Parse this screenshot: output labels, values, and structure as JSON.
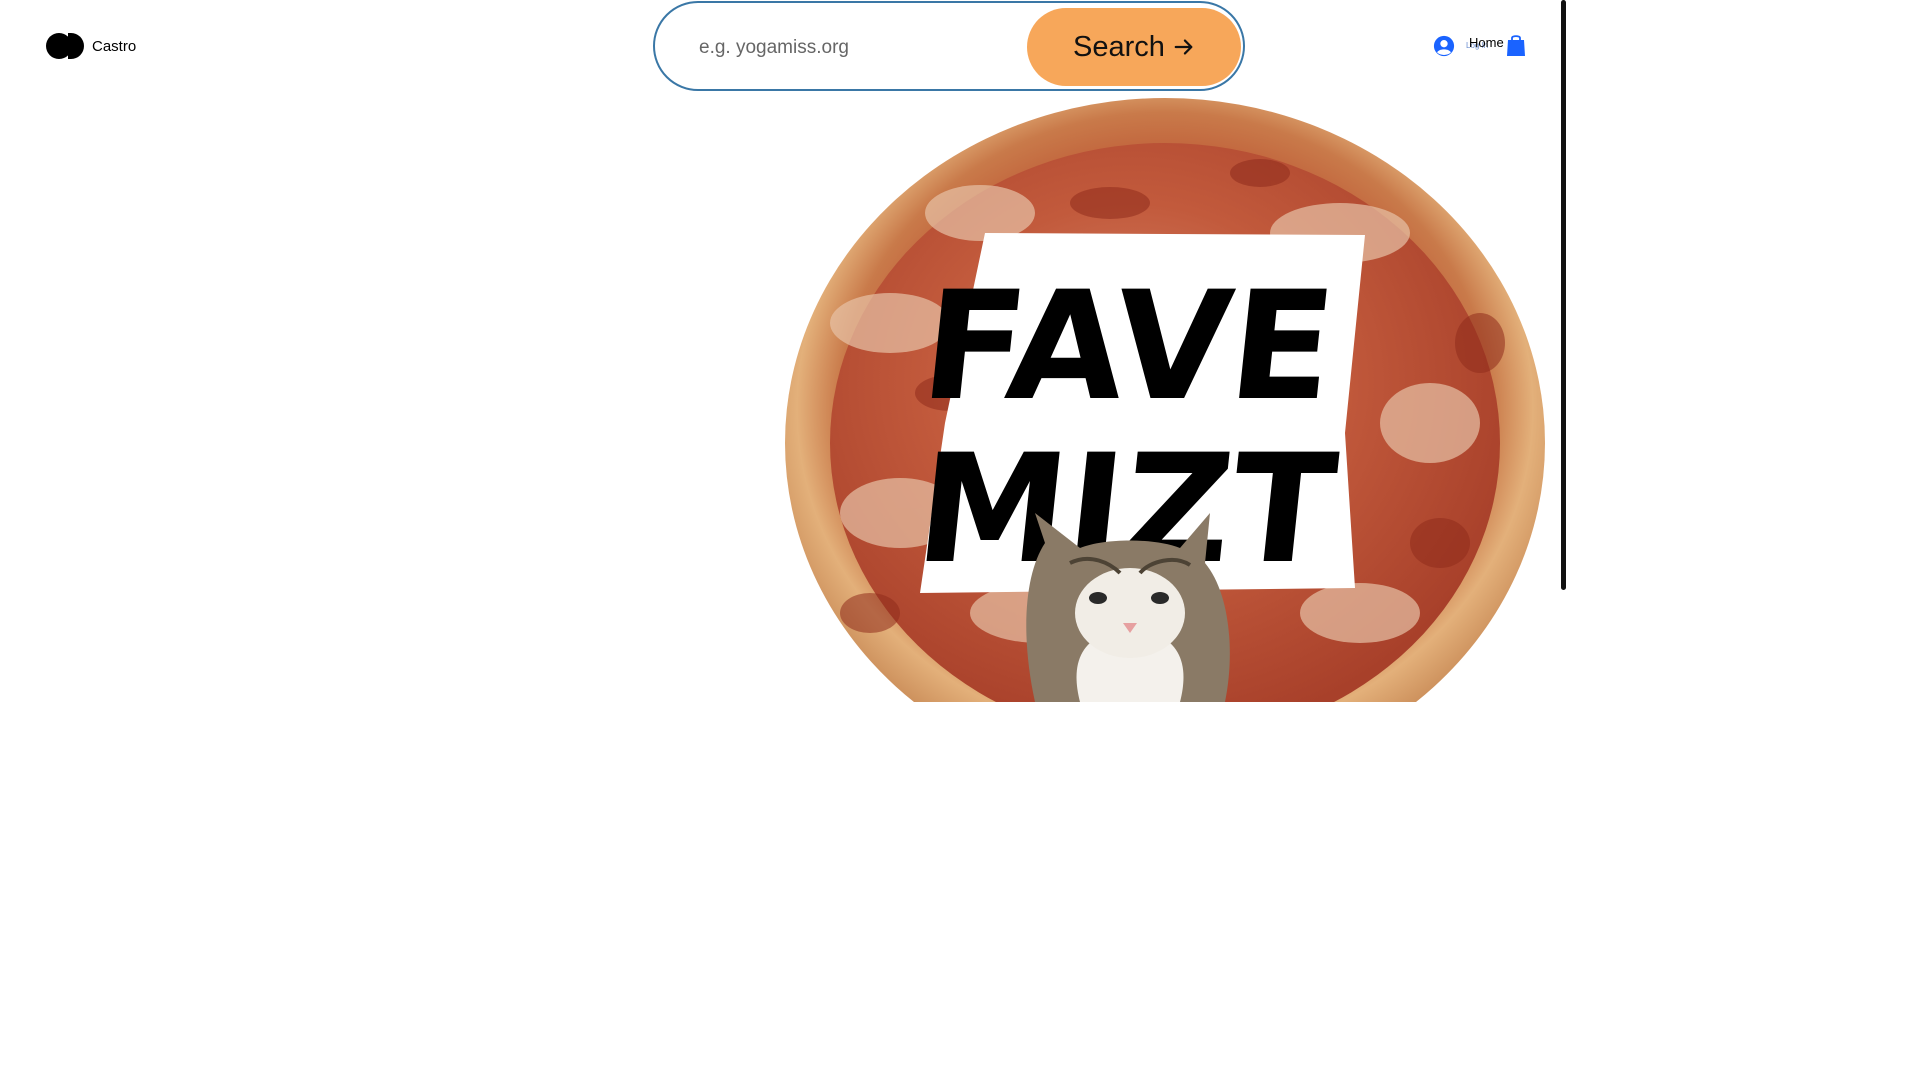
{
  "brand": {
    "name": "Castro"
  },
  "search": {
    "placeholder": "e.g. yogamiss.org",
    "button_label": "Search"
  },
  "header": {
    "login_label": "Log In",
    "home_label": "Home"
  },
  "hero": {
    "sign_line1": "FAVE",
    "sign_line2": "MIZT",
    "description_icon": "pizza-with-cat-image"
  },
  "colors": {
    "search_border": "#3a77a6",
    "search_button": "#f7a75a",
    "accent_blue": "#1a63ff"
  }
}
